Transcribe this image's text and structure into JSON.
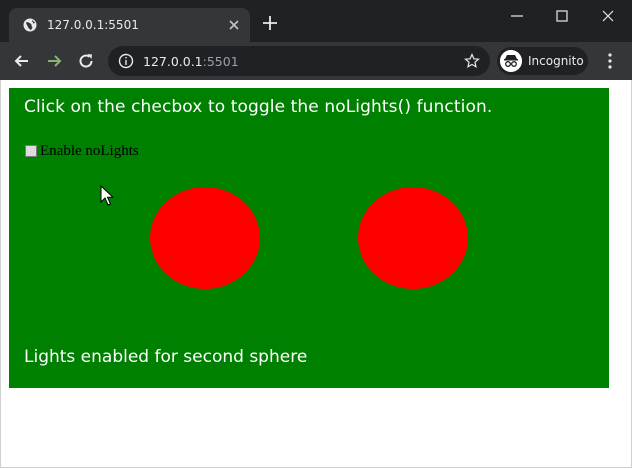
{
  "browser": {
    "tab_title": "127.0.0.1:5501",
    "url_host": "127.0.0.1",
    "url_port": ":5501",
    "profile_label": "Incognito",
    "icons": {
      "favicon": "globe-icon",
      "tab_close": "close-icon",
      "new_tab": "plus-icon",
      "back": "arrow-left-icon",
      "forward": "arrow-right-icon",
      "reload": "reload-icon",
      "site_info": "info-icon",
      "bookmark": "star-icon",
      "incognito": "incognito-icon",
      "menu": "kebab-menu-icon"
    },
    "colors": {
      "titlebar": "#202124",
      "toolbar": "#35363a",
      "forward_arrow": "#8ab472"
    }
  },
  "page": {
    "instruction": "Click on the checbox to toggle the noLights() function.",
    "checkbox_label": "Enable noLights",
    "checkbox_checked": false,
    "status_text": "Lights enabled for second sphere",
    "colors": {
      "canvas_background": "#008000",
      "sphere": "#ff0000",
      "text": "#ffffff"
    }
  }
}
